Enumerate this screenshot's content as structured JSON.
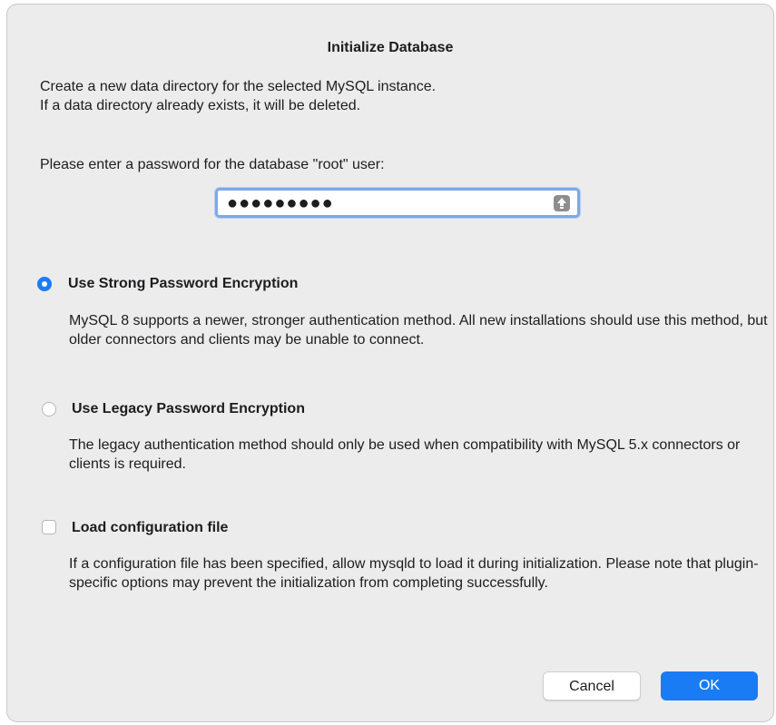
{
  "dialog": {
    "title": "Initialize Database",
    "intro_line1": "Create a new data directory for the selected MySQL instance.",
    "intro_line2": "If a data directory already exists, it will be deleted.",
    "password_prompt": "Please enter a password for the database \"root\" user:",
    "password_value": "●●●●●●●●●"
  },
  "options": {
    "strong": {
      "label": "Use Strong Password Encryption",
      "selected": true,
      "description": "MySQL 8 supports a newer, stronger authentication method. All new installations should use this method, but older connectors and clients may be unable to connect."
    },
    "legacy": {
      "label": "Use Legacy Password Encryption",
      "selected": false,
      "description": "The legacy authentication method should only be used when compatibility with MySQL 5.x connectors or clients is required."
    },
    "config": {
      "label": "Load configuration file",
      "checked": false,
      "description": "If a configuration file has been specified, allow mysqld to load it during initialization. Please note that plugin-specific options may prevent the initialization from completing successfully."
    }
  },
  "buttons": {
    "cancel": "Cancel",
    "ok": "OK"
  },
  "colors": {
    "accent": "#1a7cf5",
    "dialog_bg": "#ececec",
    "focus_ring": "#7fa8e8"
  },
  "icons": {
    "caps_lock": "caps-lock-icon"
  }
}
